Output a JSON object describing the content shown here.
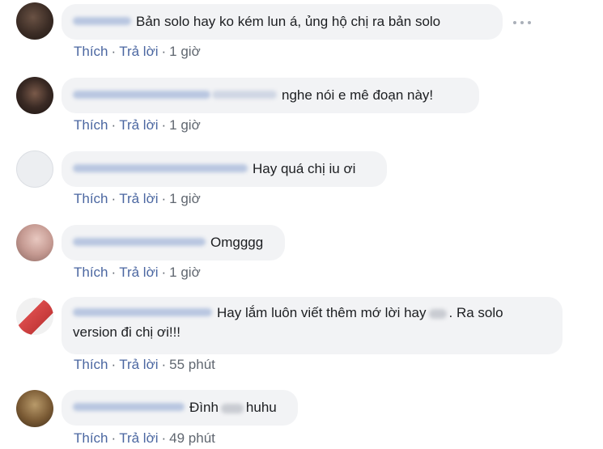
{
  "comments": [
    {
      "text": "Bản solo hay ko kém lun á, ủng hộ chị ra bản solo",
      "like": "Thích",
      "reply": "Trả lời",
      "time": "1 giờ",
      "avatar_color": "#4a3a33",
      "more_icon": "ellipsis-icon"
    },
    {
      "text": "nghe nói e mê đoạn này!",
      "like": "Thích",
      "reply": "Trả lời",
      "time": "1 giờ",
      "avatar_color": "#3a2a24"
    },
    {
      "text": "Hay quá chị iu ơi",
      "like": "Thích",
      "reply": "Trả lời",
      "time": "1 giờ",
      "avatar_color": "#e9ebee"
    },
    {
      "text": "Omgggg",
      "like": "Thích",
      "reply": "Trả lời",
      "time": "1 giờ",
      "avatar_color": "#c9a39c"
    },
    {
      "text_part1": "Hay lắm luôn viết thêm mớ lời hay",
      "text_part2": ". Ra solo",
      "text_line2": "version đi chị ơi!!!",
      "like": "Thích",
      "reply": "Trả lời",
      "time": "55 phút",
      "avatar_color": "#d94a4a"
    },
    {
      "text_part1": "Đình",
      "text_part2": "huhu",
      "like": "Thích",
      "reply": "Trả lời",
      "time": "49 phút",
      "avatar_color": "#8a6a3c"
    }
  ]
}
